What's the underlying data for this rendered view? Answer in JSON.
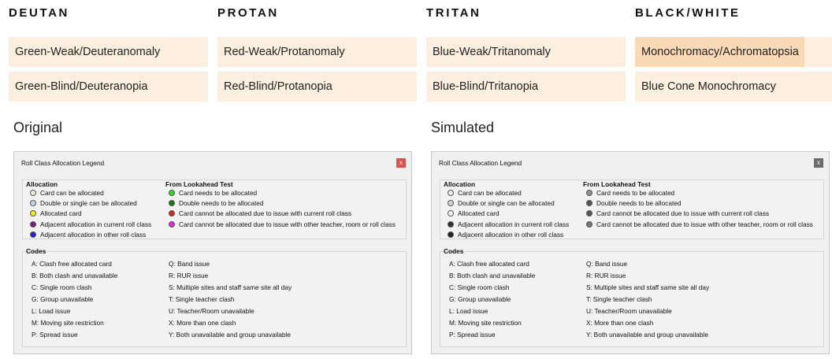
{
  "columns": [
    {
      "heading": "DEUTAN",
      "options": [
        "Green-Weak/Deuteranomaly",
        "Green-Blind/Deuteranopia"
      ]
    },
    {
      "heading": "PROTAN",
      "options": [
        "Red-Weak/Protanomaly",
        "Red-Blind/Protanopia"
      ]
    },
    {
      "heading": "TRITAN",
      "options": [
        "Blue-Weak/Tritanomaly",
        "Blue-Blind/Tritanopia"
      ]
    },
    {
      "heading": "BLACK/WHITE",
      "options": [
        "Monochromacy/Achromatopsia",
        "Blue Cone Monochromacy"
      ]
    }
  ],
  "selected_option": "Monochromacy/Achromatopsia",
  "labels": {
    "original": "Original",
    "simulated": "Simulated"
  },
  "legend": {
    "title": "Roll Class Allocation Legend",
    "close_glyph": "x",
    "allocation_header": "Allocation",
    "allocation_items": [
      "Card can be allocated",
      "Double or single can be allocated",
      "Allocated card",
      "Adjacent allocation in current roll class",
      "Adjacent allocation in other roll class"
    ],
    "lookahead_header": "From Lookahead Test",
    "lookahead_items": [
      "Card needs to be allocated",
      "Double needs to be allocated",
      "Card cannot be allocated due to issue with current roll class",
      "Card cannot be allocated due to issue with other teacher, room or roll class"
    ],
    "codes_header": "Codes",
    "codes_left": [
      "A: Clash free allocated card",
      "B: Both clash and unavailable",
      "C: Single room clash",
      "G: Group unavailable",
      "L: Load issue",
      "M: Moving site restriction",
      "P: Spread issue"
    ],
    "codes_right": [
      "Q: Band issue",
      "R: RUR issue",
      "S: Multiple sites and staff same site all day",
      "T: Single teacher clash",
      "U: Teacher/Room unavailable",
      "X: More than one clash",
      "Y: Both unavailable and group unavailable"
    ]
  },
  "colors": {
    "option_bg": "#fdefe0",
    "option_selected_bg": "#f9d9b6",
    "close_original": "#d9534f",
    "close_simulated": "#6b6b6b",
    "original_allocation_dots": [
      "#e9efd9",
      "#c6d6ee",
      "#f2ea1c",
      "#7a1d7e",
      "#2a1fd6"
    ],
    "original_lookahead_dots": [
      "#31d92a",
      "#127a12",
      "#d62a1f",
      "#dd2adf"
    ],
    "simulated_allocation_dots": [
      "#ececec",
      "#d6d6d6",
      "#f3f3f3",
      "#333333",
      "#222222"
    ],
    "simulated_lookahead_dots": [
      "#8f8f8f",
      "#555555",
      "#555555",
      "#777777"
    ]
  }
}
